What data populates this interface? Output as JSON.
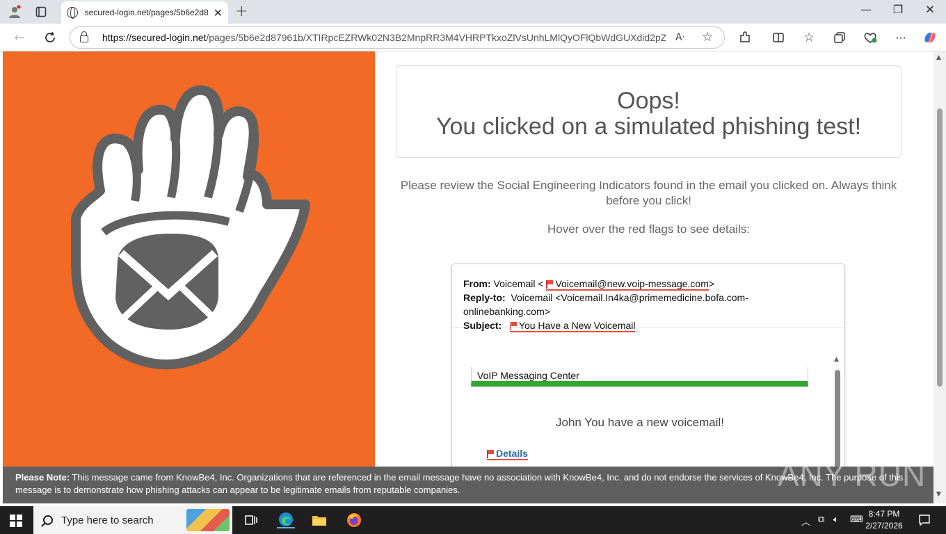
{
  "browser": {
    "tab_title": "secured-login.net/pages/5b6e2d8",
    "url_domain": "https://secured-login.net",
    "url_path": "/pages/5b6e2d87961b/XTIRpcEZRWk02N3B2MnpRR3M4VHRPTkxoZlVsUnhLMlQyOFlQbWdGUXdid2pZ..."
  },
  "page": {
    "heading_line1": "Oops!",
    "heading_line2": "You clicked on a simulated phishing test!",
    "review_text": "Please review the Social Engineering Indicators found in the email you clicked on. Always think before you click!",
    "hover_text": "Hover over the red flags to see details:"
  },
  "email": {
    "from_label": "From:",
    "from_name": "Voicemail <",
    "from_address": "Voicemail@new.voip-message.com",
    "from_close": ">",
    "replyto_label": "Reply-to:",
    "replyto_value": "Voicemail <Voicemail.In4ka@primemedicine.bofa.com-onlinebanking.com>",
    "subject_label": "Subject:",
    "subject_value": "You Have a New Voicemail",
    "banner": "VoIP Messaging Center",
    "message": "John You have a new voicemail!",
    "details_link": "Details"
  },
  "note": {
    "label": "Please Note:",
    "text": "This message came from KnowBe4, Inc. Organizations that are referenced in the email message have no association with KnowBe4, Inc. and do not endorse the services of KnowBe4, Inc. The purpose of this message is to demonstrate how phishing attacks can appear to be legitimate emails from reputable companies."
  },
  "watermark": "ANY RUN",
  "taskbar": {
    "search_placeholder": "Type here to search",
    "time": "8:47 PM",
    "date": "2/27/2026"
  },
  "colors": {
    "orange_panel": "#f26a26",
    "flag_red": "#e64d3d",
    "banner_green": "#33a532",
    "link_blue": "#2a6fb0"
  }
}
